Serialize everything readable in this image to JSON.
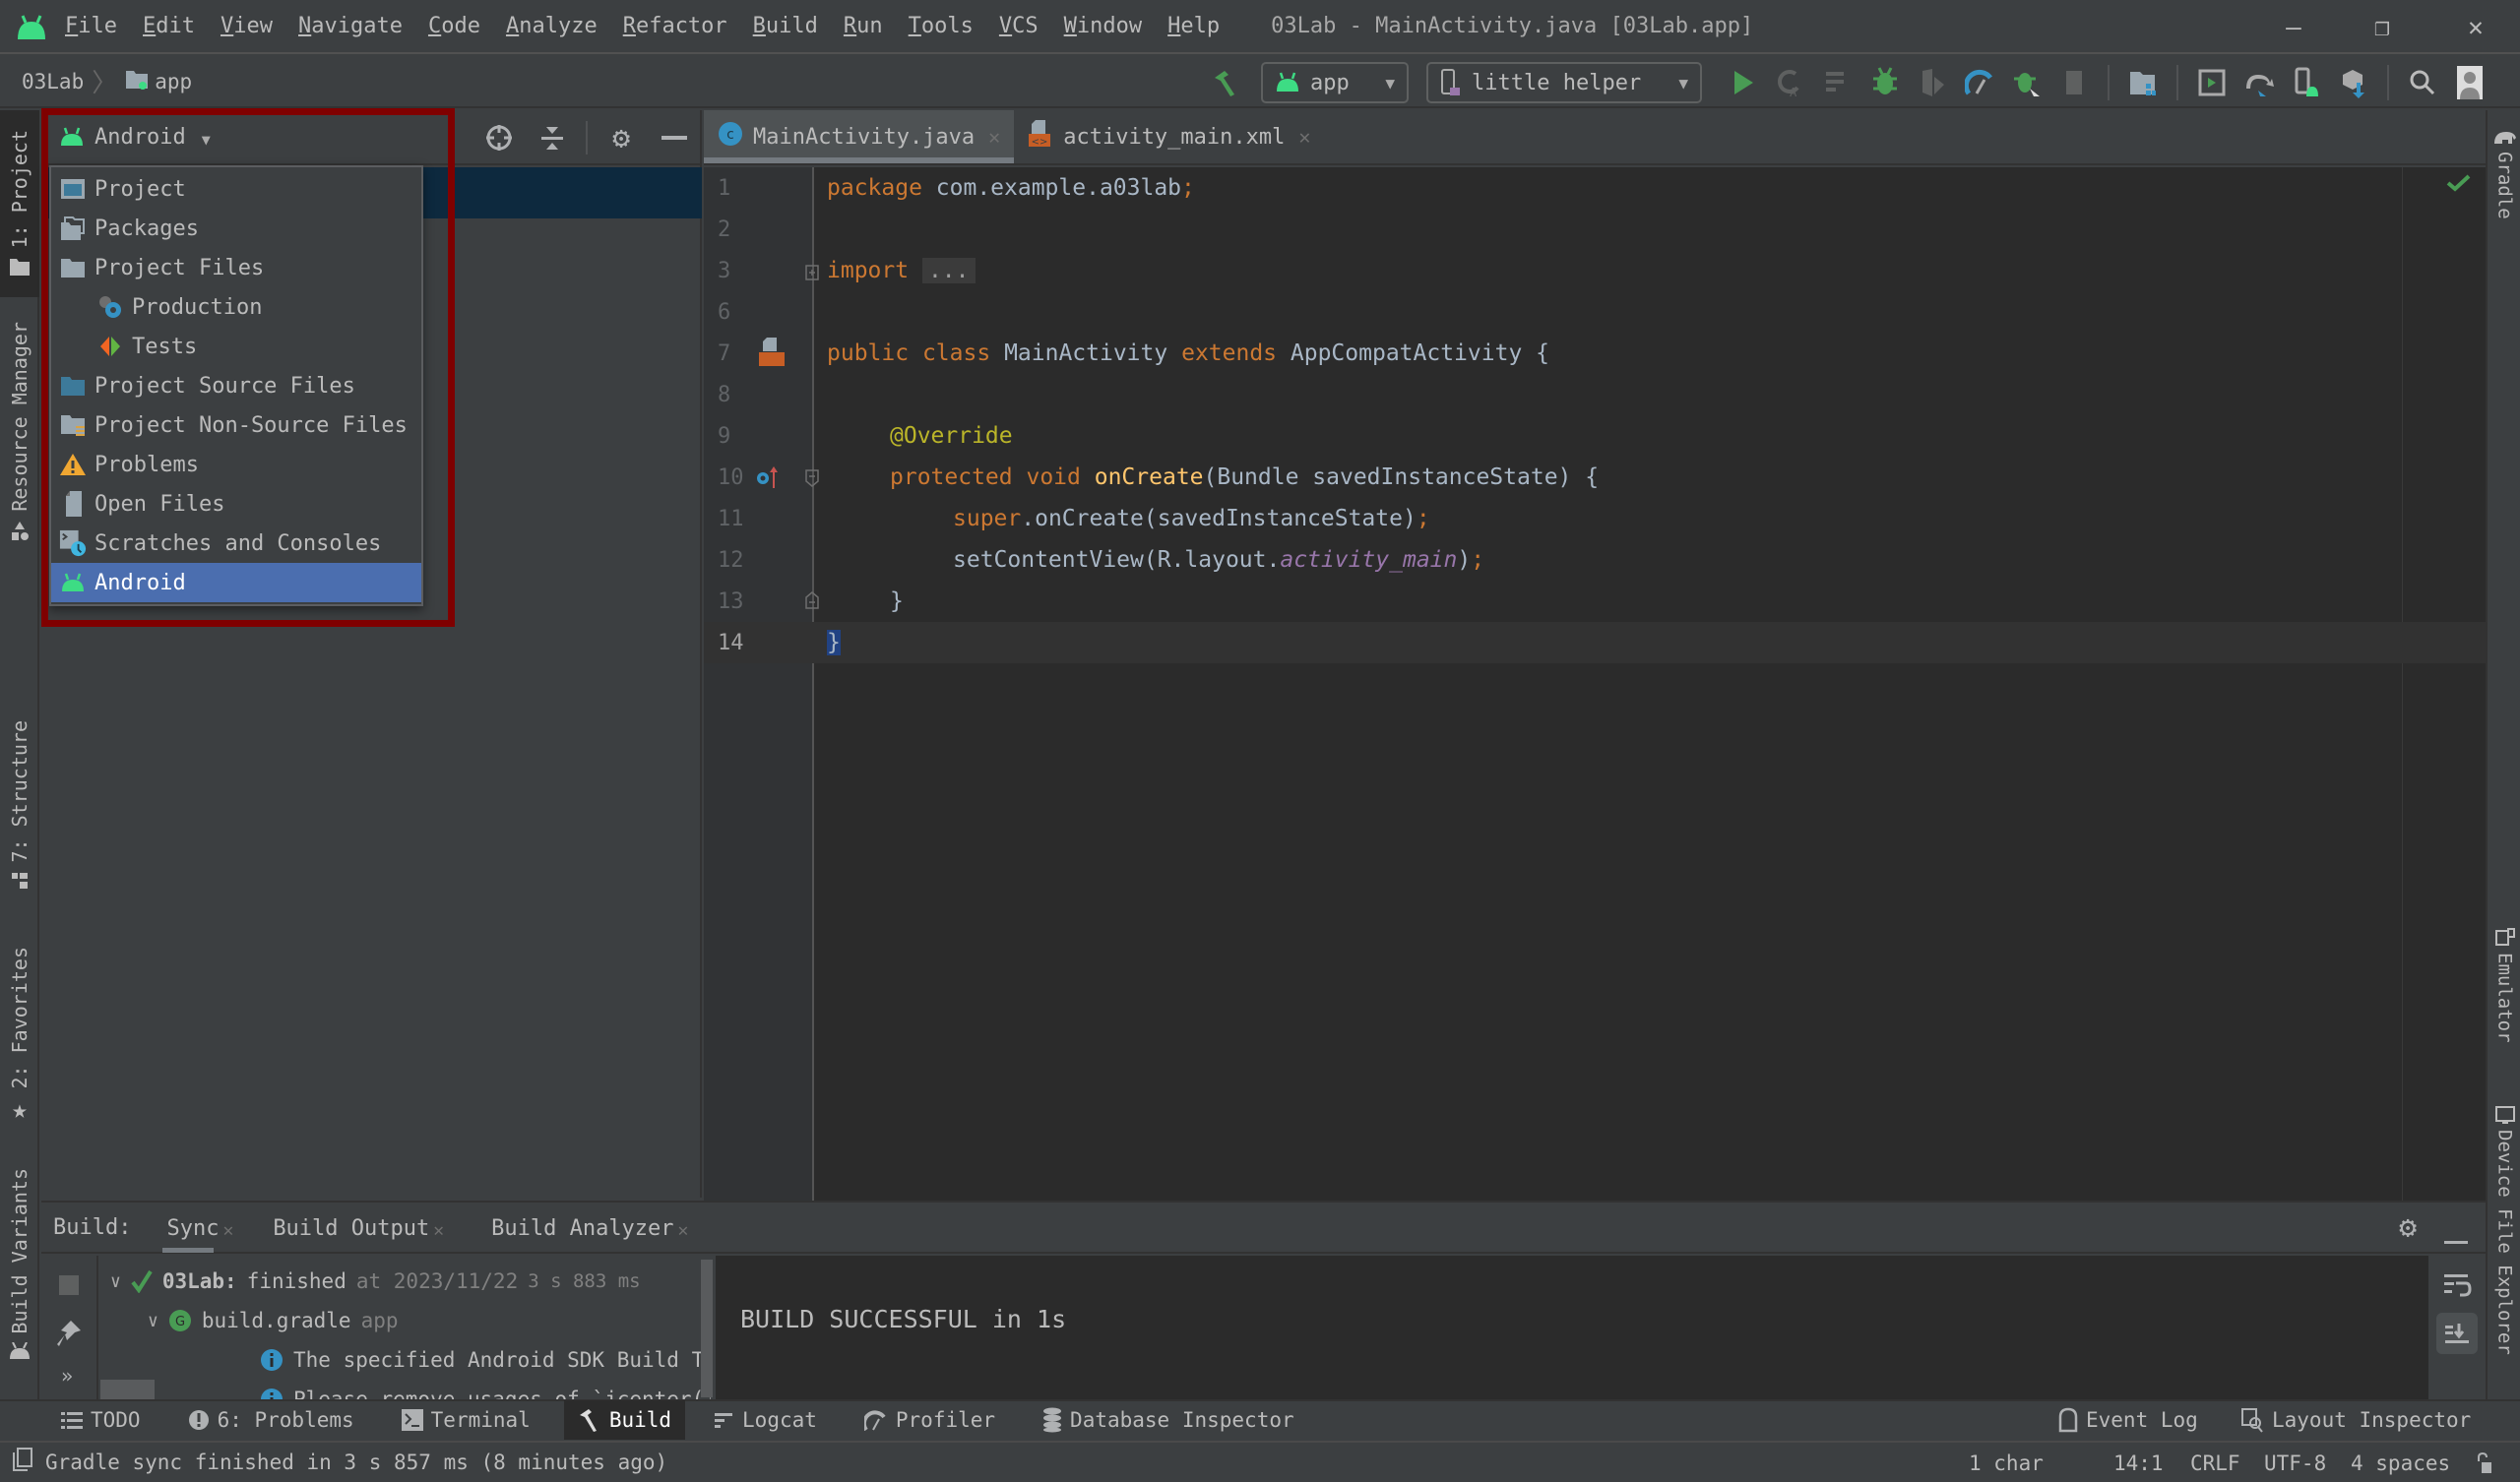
{
  "menubar": {
    "items": [
      "File",
      "Edit",
      "View",
      "Navigate",
      "Code",
      "Analyze",
      "Refactor",
      "Build",
      "Run",
      "Tools",
      "VCS",
      "Window",
      "Help"
    ],
    "window_title": "03Lab - MainActivity.java [03Lab.app]",
    "controls": {
      "minimize": "—",
      "restore": "❐",
      "close": "✕"
    }
  },
  "navbar": {
    "breadcrumb": [
      "03Lab",
      "app"
    ],
    "run_config": "app",
    "device": "little helper",
    "icons": [
      "hammer-icon",
      "run-icon",
      "apply-changes-icon",
      "apply-code-changes-icon",
      "debug-icon",
      "attach-coverage-icon",
      "profile-icon",
      "attach-debugger-icon",
      "stop-icon",
      "project-structure-icon",
      "avd-manager-icon",
      "gradle-sync-icon",
      "sdk-manager-icon",
      "resource-download-icon",
      "search-icon",
      "account-icon"
    ]
  },
  "left_strip": {
    "tabs": [
      {
        "label": "1: Project",
        "active": true
      },
      {
        "label": "Resource Manager",
        "active": false
      },
      {
        "label": "7: Structure",
        "active": false
      },
      {
        "label": "2: Favorites",
        "active": false
      },
      {
        "label": "Build Variants",
        "active": false
      }
    ]
  },
  "right_strip": {
    "tabs": [
      "Gradle",
      "Emulator",
      "Device File Explorer"
    ]
  },
  "project_panel": {
    "view_selector": "Android",
    "popup_items": [
      {
        "label": "Project",
        "icon": "project-icon",
        "indent": false,
        "selected": false
      },
      {
        "label": "Packages",
        "icon": "packages-icon",
        "indent": false,
        "selected": false
      },
      {
        "label": "Project Files",
        "icon": "folder-icon",
        "indent": false,
        "selected": false
      },
      {
        "label": "Production",
        "icon": "production-gear-icon",
        "indent": true,
        "selected": false
      },
      {
        "label": "Tests",
        "icon": "tests-icon",
        "indent": true,
        "selected": false
      },
      {
        "label": "Project Source Files",
        "icon": "source-folder-icon",
        "indent": false,
        "selected": false
      },
      {
        "label": "Project Non-Source Files",
        "icon": "non-source-folder-icon",
        "indent": false,
        "selected": false
      },
      {
        "label": "Problems",
        "icon": "warning-icon",
        "indent": false,
        "selected": false
      },
      {
        "label": "Open Files",
        "icon": "file-icon",
        "indent": false,
        "selected": false
      },
      {
        "label": "Scratches and Consoles",
        "icon": "scratches-icon",
        "indent": false,
        "selected": false
      },
      {
        "label": "Android",
        "icon": "android-icon",
        "indent": false,
        "selected": true
      }
    ]
  },
  "editor": {
    "tabs": [
      {
        "label": "MainActivity.java",
        "active": true
      },
      {
        "label": "activity_main.xml",
        "active": false
      }
    ],
    "lines": [
      {
        "num": "1",
        "text": "package com.example.a03lab;"
      },
      {
        "num": "2",
        "text": ""
      },
      {
        "num": "3",
        "text": "import ..."
      },
      {
        "num": "6",
        "text": ""
      },
      {
        "num": "7",
        "text": "public class MainActivity extends AppCompatActivity {"
      },
      {
        "num": "8",
        "text": ""
      },
      {
        "num": "9",
        "text": "    @Override"
      },
      {
        "num": "10",
        "text": "    protected void onCreate(Bundle savedInstanceState) {"
      },
      {
        "num": "11",
        "text": "        super.onCreate(savedInstanceState);"
      },
      {
        "num": "12",
        "text": "        setContentView(R.layout.activity_main);"
      },
      {
        "num": "13",
        "text": "    }"
      },
      {
        "num": "14",
        "text": "}"
      }
    ],
    "current_line": "14",
    "tokens": {
      "package_kw": "package",
      "package_name": " com.example.a03lab",
      "semi": ";",
      "import_kw": "import",
      "import_fold": "...",
      "public_kw": "public",
      "class_kw": "class",
      "class_name": "MainActivity",
      "extends_kw": "extends",
      "super_class": "AppCompatActivity",
      "open_brace": "{",
      "annotation": "@Override",
      "protected_kw": "protected",
      "void_kw": "void",
      "method": "onCreate",
      "params": "(Bundle savedInstanceState) ",
      "super_kw": "super",
      "super_call": ".onCreate(savedInstanceState)",
      "set_content": "setContentView(R.layout.",
      "layout_field": "activity_main",
      "close_paren": ")",
      "close_brace": "}"
    }
  },
  "build_panel": {
    "label": "Build:",
    "tabs": [
      {
        "label": "Sync",
        "active": true
      },
      {
        "label": "Build Output",
        "active": false
      },
      {
        "label": "Build Analyzer",
        "active": false
      }
    ],
    "tree": [
      {
        "title": "03Lab:",
        "status": "finished",
        "detail": "at 2023/11/22",
        "duration": "3 s 883 ms"
      },
      {
        "title": "build.gradle",
        "detail": "app"
      },
      {
        "message": "The specified Android SDK Build To"
      },
      {
        "message": "Please remove usages of `jcenter()"
      }
    ],
    "console": "BUILD SUCCESSFUL in 1s"
  },
  "toolwindows": {
    "left": [
      {
        "label": "TODO",
        "icon": "todo-icon",
        "active": false
      },
      {
        "label": "6: Problems",
        "icon": "problems-icon",
        "active": false
      },
      {
        "label": "Terminal",
        "icon": "terminal-icon",
        "active": false
      },
      {
        "label": "Build",
        "icon": "hammer-icon",
        "active": true
      },
      {
        "label": "Logcat",
        "icon": "logcat-icon",
        "active": false
      },
      {
        "label": "Profiler",
        "icon": "profiler-icon",
        "active": false
      },
      {
        "label": "Database Inspector",
        "icon": "database-icon",
        "active": false
      }
    ],
    "right": [
      {
        "label": "Event Log",
        "icon": "event-log-icon"
      },
      {
        "label": "Layout Inspector",
        "icon": "layout-inspector-icon"
      }
    ]
  },
  "statusbar": {
    "message": "Gradle sync finished in 3 s 857 ms (8 minutes ago)",
    "selection": "1 char",
    "position": "14:1",
    "line_separator": "CRLF",
    "encoding": "UTF-8",
    "indent": "4 spaces"
  },
  "colors": {
    "accent_selected": "#4b6eaf",
    "android_green": "#3ddc84",
    "highlight_box": "#7f0000",
    "editor_bg": "#2b2b2b",
    "panel_bg": "#3c3f41"
  }
}
